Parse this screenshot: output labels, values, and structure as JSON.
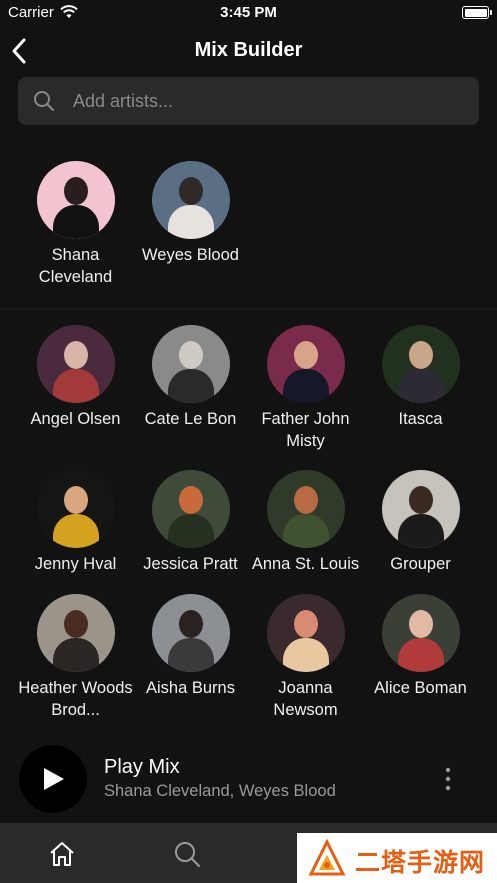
{
  "status_bar": {
    "carrier": "Carrier",
    "time": "3:45 PM"
  },
  "header": {
    "title": "Mix Builder"
  },
  "search": {
    "placeholder": "Add artists..."
  },
  "selected_artists": [
    {
      "name": "Shana Cleveland",
      "colors": [
        "#f2c4cf",
        "#2a1d1d",
        "#111111"
      ]
    },
    {
      "name": "Weyes Blood",
      "colors": [
        "#5b6f84",
        "#2f2a28",
        "#e7e2de"
      ]
    }
  ],
  "suggested_artists": [
    {
      "name": "Angel Olsen",
      "colors": [
        "#4a2a3c",
        "#d9b4a8",
        "#a23a3a"
      ]
    },
    {
      "name": "Cate Le Bon",
      "colors": [
        "#8a8a8a",
        "#cfcac4",
        "#2a2a2a"
      ]
    },
    {
      "name": "Father John Misty",
      "colors": [
        "#7a2a4a",
        "#d7a48a",
        "#151828"
      ]
    },
    {
      "name": "Itasca",
      "colors": [
        "#22301f",
        "#c9a58a",
        "#2d2a36"
      ]
    },
    {
      "name": "Jenny Hval",
      "colors": [
        "#151515",
        "#d9a680",
        "#d4a21e"
      ]
    },
    {
      "name": "Jessica Pratt",
      "colors": [
        "#3e4a3a",
        "#c96a3a",
        "#263021"
      ]
    },
    {
      "name": "Anna St. Louis",
      "colors": [
        "#2f3a2a",
        "#b86a42",
        "#40522f"
      ]
    },
    {
      "name": "Grouper",
      "colors": [
        "#c6c3bc",
        "#3a2a24",
        "#1b1b1b"
      ]
    },
    {
      "name": "Heather Woods Brod...",
      "colors": [
        "#9a948a",
        "#4a2d22",
        "#2b2523"
      ]
    },
    {
      "name": "Aisha Burns",
      "colors": [
        "#8c8f93",
        "#2a2220",
        "#3a3a3a"
      ]
    },
    {
      "name": "Joanna Newsom",
      "colors": [
        "#3a2a2e",
        "#d88a72",
        "#e9c7a0"
      ]
    },
    {
      "name": "Alice Boman",
      "colors": [
        "#3b4036",
        "#e2b9a4",
        "#b13a3a"
      ]
    }
  ],
  "play_mix": {
    "title": "Play Mix",
    "subtitle": "Shana Cleveland, Weyes Blood"
  },
  "tabbar": {
    "items": [
      "home-icon",
      "search-icon"
    ]
  },
  "watermark": {
    "text": "二塔手游网"
  }
}
